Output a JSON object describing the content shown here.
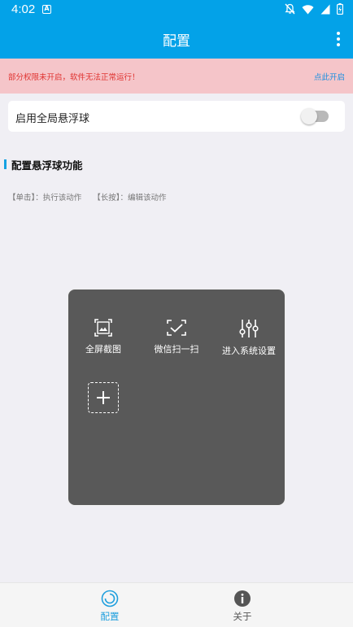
{
  "status_bar": {
    "time": "4:02",
    "notification_glyph": "A"
  },
  "app_bar": {
    "title": "配置"
  },
  "warning": {
    "text": "部分权限未开启，软件无法正常运行！",
    "action": "点此开启",
    "text_color": "#e0322f",
    "link_color": "#1a8fe0",
    "background": "#f5c5c9"
  },
  "global_float": {
    "label": "启用全局悬浮球",
    "enabled": false
  },
  "section": {
    "title": "配置悬浮球功能",
    "hint_tap": "【单击】：执行该动作",
    "hint_long_press": "【长按】：编辑该动作"
  },
  "float_panel": {
    "items": [
      {
        "label": "全屏截图",
        "icon": "screenshot-icon"
      },
      {
        "label": "微信扫一扫",
        "icon": "scan-icon"
      },
      {
        "label": "进入系统设置",
        "icon": "settings-sliders-icon"
      }
    ],
    "add_icon": "plus-icon"
  },
  "bottom_nav": {
    "items": [
      {
        "label": "配置",
        "icon": "config-ring-icon",
        "active": true
      },
      {
        "label": "关于",
        "icon": "info-icon",
        "active": false
      }
    ]
  },
  "colors": {
    "primary": "#03a2e8",
    "panel": "#595959",
    "page_bg": "#f0eff4"
  }
}
